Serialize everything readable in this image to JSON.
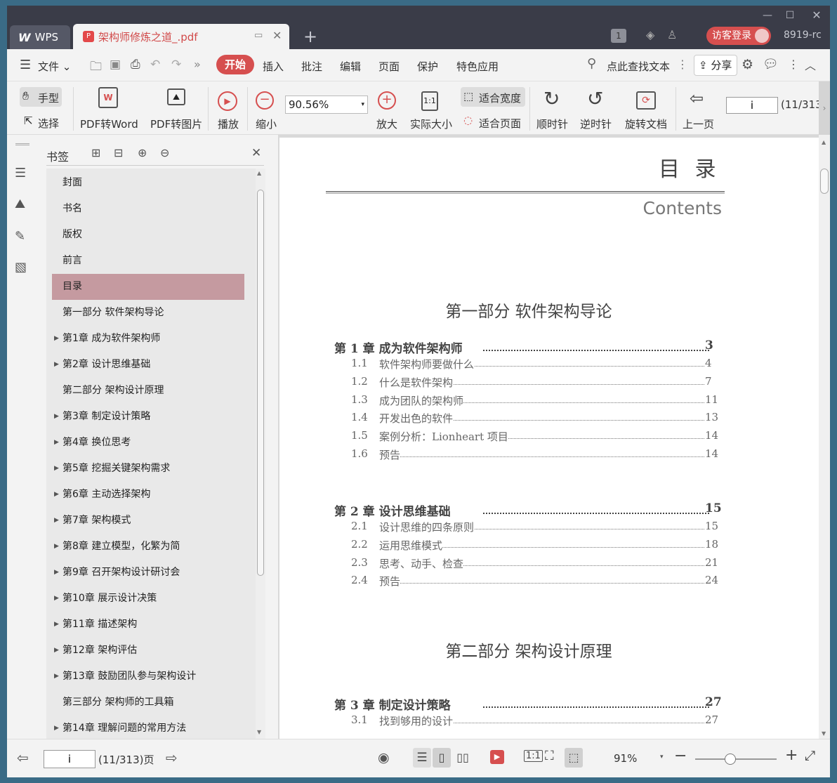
{
  "app": {
    "brand": "WPS",
    "tab_title": "架构师修炼之道_.pdf",
    "page_badge": "1",
    "login_label": "访客登录",
    "user_tail": "8919-rc"
  },
  "menubar": {
    "file": "文件",
    "items": [
      "开始",
      "插入",
      "批注",
      "编辑",
      "页面",
      "保护",
      "特色应用"
    ],
    "search": "点此查找文本",
    "share": "分享"
  },
  "toolbar": {
    "hand": "手型",
    "select": "选择",
    "pdf_to_word": "PDF转Word",
    "pdf_to_image": "PDF转图片",
    "play": "播放",
    "zoom_out": "缩小",
    "zoom_value": "90.56%",
    "zoom_in": "放大",
    "actual_size": "实际大小",
    "fit_width": "适合宽度",
    "fit_page": "适合页面",
    "clockwise": "顺时针",
    "counterclockwise": "逆时针",
    "rotate_doc": "旋转文档",
    "prev_page": "上一页",
    "page_input": "i",
    "page_count": "(11/313"
  },
  "bookmarks": {
    "title": "书签",
    "items": [
      {
        "label": "封面",
        "arrow": false
      },
      {
        "label": "书名",
        "arrow": false
      },
      {
        "label": "版权",
        "arrow": false
      },
      {
        "label": "前言",
        "arrow": false
      },
      {
        "label": "目录",
        "arrow": false,
        "selected": true
      },
      {
        "label": "第一部分  软件架构导论",
        "arrow": false
      },
      {
        "label": "第1章  成为软件架构师",
        "arrow": true
      },
      {
        "label": "第2章  设计思维基础",
        "arrow": true
      },
      {
        "label": "第二部分  架构设计原理",
        "arrow": false
      },
      {
        "label": "第3章  制定设计策略",
        "arrow": true
      },
      {
        "label": "第4章  换位思考",
        "arrow": true
      },
      {
        "label": "第5章  挖掘关键架构需求",
        "arrow": true
      },
      {
        "label": "第6章  主动选择架构",
        "arrow": true
      },
      {
        "label": "第7章  架构模式",
        "arrow": true
      },
      {
        "label": "第8章  建立模型，化繁为简",
        "arrow": true
      },
      {
        "label": "第9章  召开架构设计研讨会",
        "arrow": true
      },
      {
        "label": "第10章  展示设计决策",
        "arrow": true
      },
      {
        "label": "第11章  描述架构",
        "arrow": true
      },
      {
        "label": "第12章  架构评估",
        "arrow": true
      },
      {
        "label": "第13章  鼓励团队参与架构设计",
        "arrow": true
      },
      {
        "label": "第三部分  架构师的工具箱",
        "arrow": false
      },
      {
        "label": "第14章  理解问题的常用方法",
        "arrow": true
      }
    ]
  },
  "document": {
    "heading": "目  录",
    "subheading": "Contents",
    "part1": "第一部分  软件架构导论",
    "ch1": {
      "label": "第 1 章  成为软件架构师",
      "page": "3"
    },
    "ch1_sections": [
      {
        "num": "1.1",
        "title": "软件架构师要做什么",
        "page": "4"
      },
      {
        "num": "1.2",
        "title": "什么是软件架构",
        "page": "7"
      },
      {
        "num": "1.3",
        "title": "成为团队的架构师",
        "page": "11"
      },
      {
        "num": "1.4",
        "title": "开发出色的软件",
        "page": "13"
      },
      {
        "num": "1.5",
        "title": "案例分析：Lionheart 项目",
        "page": "14"
      },
      {
        "num": "1.6",
        "title": "预告",
        "page": "14"
      }
    ],
    "ch2": {
      "label": "第 2 章  设计思维基础",
      "page": "15"
    },
    "ch2_sections": [
      {
        "num": "2.1",
        "title": "设计思维的四条原则",
        "page": "15"
      },
      {
        "num": "2.2",
        "title": "运用思维模式",
        "page": "18"
      },
      {
        "num": "2.3",
        "title": "思考、动手、检查",
        "page": "21"
      },
      {
        "num": "2.4",
        "title": "预告",
        "page": "24"
      }
    ],
    "part2": "第二部分  架构设计原理",
    "ch3": {
      "label": "第 3 章  制定设计策略",
      "page": "27"
    },
    "ch3_sections": [
      {
        "num": "3.1",
        "title": "找到够用的设计",
        "page": "27"
      }
    ]
  },
  "statusbar": {
    "page_input": "i",
    "page_info": "(11/313)页",
    "zoom": "91%"
  },
  "colors": {
    "accent": "#d64f4f",
    "selection": "#c59aa0",
    "titlebar": "#3a3c48"
  }
}
